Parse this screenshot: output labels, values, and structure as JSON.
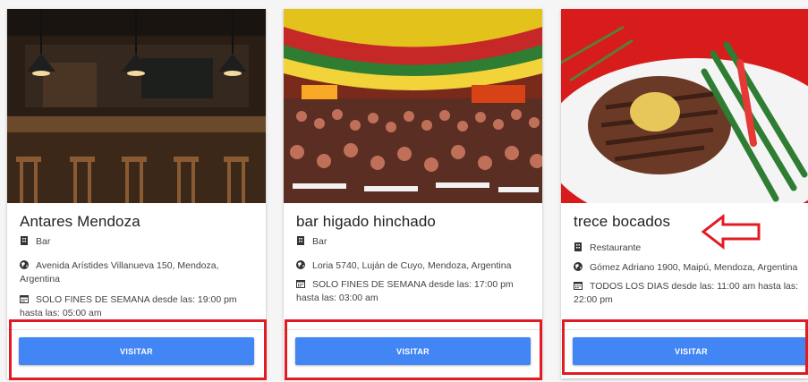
{
  "cards": [
    {
      "name": "Antares Mendoza",
      "category": "Bar",
      "address_line1": "Avenida Arístides Villanueva 150, Mendoza,",
      "address_line2": "Argentina",
      "schedule_line1": "SOLO FINES DE SEMANA desde las: 19:00 pm",
      "schedule_line2": "hasta las: 05:00 am",
      "button_label": "VISITAR"
    },
    {
      "name": "bar higado hinchado",
      "category": "Bar",
      "address_line1": "Loria 5740, Luján de Cuyo, Mendoza, Argentina",
      "schedule_line1": "SOLO FINES DE SEMANA desde las: 17:00 pm",
      "schedule_line2": "hasta las: 03:00 am",
      "button_label": "VISITAR"
    },
    {
      "name": "trece bocados",
      "category": "Restaurante",
      "address_line1": "Gómez Adriano 1900, Maipú, Mendoza, Argentina",
      "schedule_line1": "TODOS LOS DIAS desde las: 11:00 am hasta las:",
      "schedule_line2": "22:00 pm",
      "button_label": "VISITAR"
    }
  ],
  "icons": {
    "category": "building-icon",
    "address": "globe-icon",
    "schedule": "calendar-icon"
  },
  "colors": {
    "button": "#4285f4",
    "highlight": "#e21b23"
  }
}
